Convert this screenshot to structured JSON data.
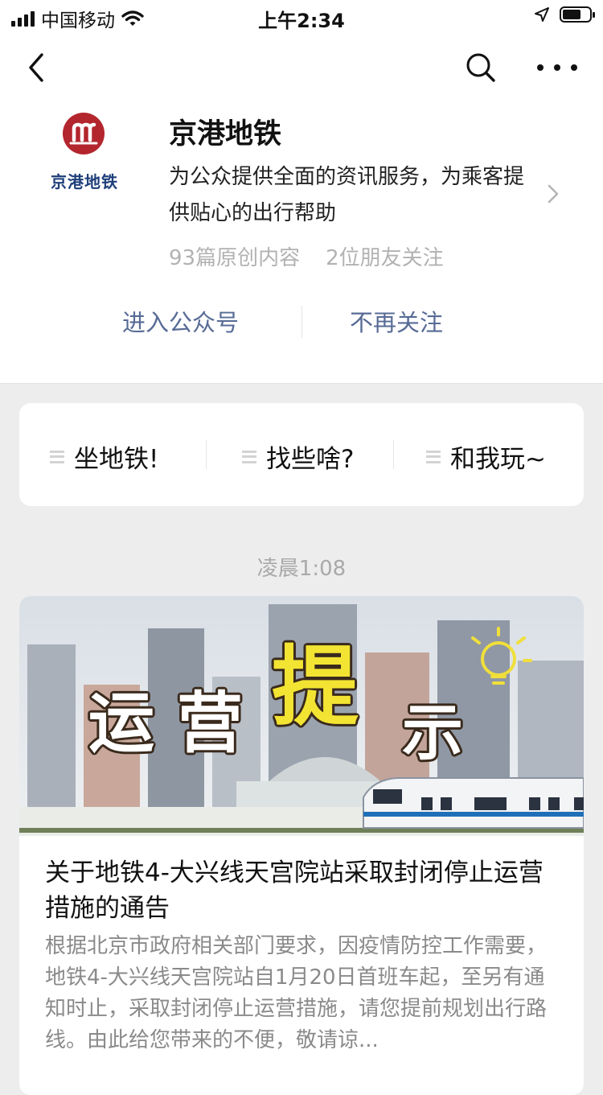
{
  "status_bar": {
    "carrier": "中国移动",
    "time": "上午2:34"
  },
  "nav": {
    "back_icon": "chevron-left-icon",
    "search_icon": "search-icon",
    "more_icon": "more-icon"
  },
  "account": {
    "name": "京港地铁",
    "logo_text": "京港地铁",
    "description": "为公众提供全面的资讯服务，为乘客提供贴心的出行帮助",
    "original_count": "93篇原创内容",
    "friends_following": "2位朋友关注",
    "enter_label": "进入公众号",
    "unfollow_label": "不再关注",
    "brand_color": "#b3262e"
  },
  "menu": {
    "items": [
      {
        "label": "坐地铁!"
      },
      {
        "label": "找些啥?"
      },
      {
        "label": "和我玩~"
      }
    ]
  },
  "feed": {
    "timestamp": "凌晨1:08",
    "article": {
      "cover_text": [
        "运",
        "营",
        "提",
        "示"
      ],
      "title": "关于地铁4-大兴线天宫院站采取封闭停止运营措施的通告",
      "digest": "根据北京市政府相关部门要求，因疫情防控工作需要，地铁4-大兴线天宫院站自1月20日首班车起，至另有通知时止，采取封闭停止运营措施，请您提前规划出行路线。由此给您带来的不便，敬请谅..."
    }
  }
}
